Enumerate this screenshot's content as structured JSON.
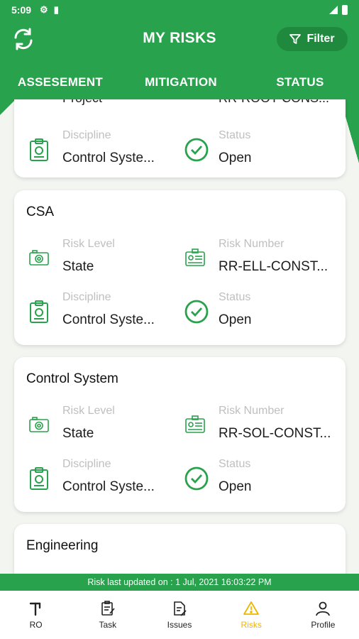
{
  "status_bar": {
    "time": "5:09"
  },
  "header": {
    "title": "MY RISKS",
    "filter_label": "Filter",
    "tabs": [
      "ASSESEMENT",
      "MITIGATION",
      "STATUS"
    ]
  },
  "partial_top": {
    "left_text": "Project",
    "right_text": "RR-ROOT-CONS..."
  },
  "cards": [
    {
      "title": "",
      "fields": [
        {
          "label": "Discipline",
          "value": "Control Syste...",
          "icon": "clipboard-icon"
        },
        {
          "label": "Status",
          "value": "Open",
          "icon": "check-circle-icon"
        }
      ]
    },
    {
      "title": "CSA",
      "fields": [
        {
          "label": "Risk Level",
          "value": "State",
          "icon": "camera-icon"
        },
        {
          "label": "Risk Number",
          "value": "RR-ELL-CONST...",
          "icon": "id-card-icon"
        },
        {
          "label": "Discipline",
          "value": "Control Syste...",
          "icon": "clipboard-icon"
        },
        {
          "label": "Status",
          "value": "Open",
          "icon": "check-circle-icon"
        }
      ]
    },
    {
      "title": "Control System",
      "fields": [
        {
          "label": "Risk Level",
          "value": "State",
          "icon": "camera-icon"
        },
        {
          "label": "Risk Number",
          "value": "RR-SOL-CONST...",
          "icon": "id-card-icon"
        },
        {
          "label": "Discipline",
          "value": "Control Syste...",
          "icon": "clipboard-icon"
        },
        {
          "label": "Status",
          "value": "Open",
          "icon": "check-circle-icon"
        }
      ]
    },
    {
      "title": "Engineering",
      "fields": []
    }
  ],
  "footer": {
    "updated_text": "Risk last updated on : 1 Jul, 2021 16:03:22 PM"
  },
  "bottom_nav": [
    {
      "label": "RO",
      "icon": "ro-icon"
    },
    {
      "label": "Task",
      "icon": "task-icon"
    },
    {
      "label": "Issues",
      "icon": "issues-icon"
    },
    {
      "label": "Risks",
      "icon": "warning-icon",
      "active": true
    },
    {
      "label": "Profile",
      "icon": "profile-icon"
    }
  ],
  "colors": {
    "primary": "#28a24c",
    "active_nav": "#f0b400",
    "label_grey": "#bfbfbf"
  }
}
